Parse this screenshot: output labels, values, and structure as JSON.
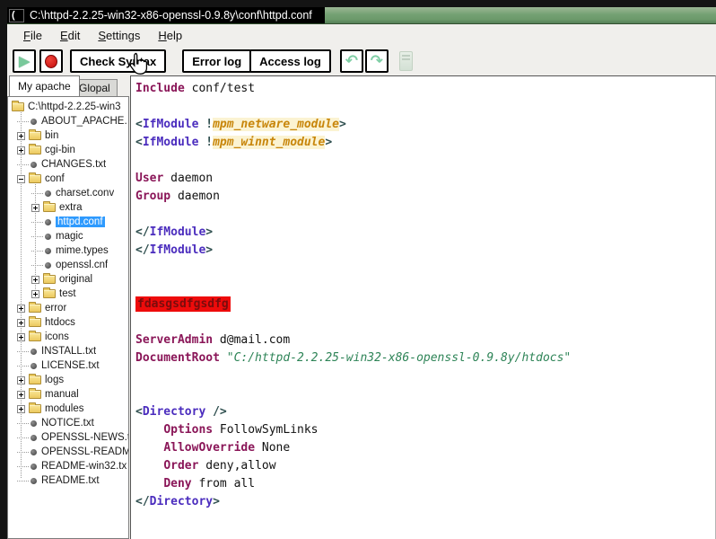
{
  "window": {
    "title": "C:\\httpd-2.2.25-win32-x86-openssl-0.9.8y\\conf\\httpd.conf",
    "app_icon_glyph": "("
  },
  "menu": {
    "items": [
      {
        "label": "File"
      },
      {
        "label": "Edit"
      },
      {
        "label": "Settings"
      },
      {
        "label": "Help"
      }
    ]
  },
  "toolbar": {
    "check_syntax_label": "Check Syntax",
    "error_log_label": "Error log",
    "access_log_label": "Access log",
    "play_glyph": "▶",
    "undo_glyph": "↶",
    "redo_glyph": "↷"
  },
  "sidebar": {
    "tabs": [
      {
        "label": "My apache",
        "active": true
      },
      {
        "label": "Glopal",
        "active": false
      }
    ],
    "tree": [
      {
        "label": "C:\\httpd-2.2.25-win3",
        "type": "folder",
        "depth": 0,
        "expand": "none",
        "selected": false
      },
      {
        "label": "ABOUT_APACHE.",
        "type": "file",
        "depth": 1,
        "expand": "none",
        "selected": false
      },
      {
        "label": "bin",
        "type": "folder",
        "depth": 1,
        "expand": "plus",
        "selected": false
      },
      {
        "label": "cgi-bin",
        "type": "folder",
        "depth": 1,
        "expand": "plus",
        "selected": false
      },
      {
        "label": "CHANGES.txt",
        "type": "file",
        "depth": 1,
        "expand": "none",
        "selected": false
      },
      {
        "label": "conf",
        "type": "folder",
        "depth": 1,
        "expand": "minus",
        "selected": false
      },
      {
        "label": "charset.conv",
        "type": "file",
        "depth": 2,
        "expand": "none",
        "selected": false
      },
      {
        "label": "extra",
        "type": "folder",
        "depth": 2,
        "expand": "plus",
        "selected": false
      },
      {
        "label": "httpd.conf",
        "type": "file",
        "depth": 2,
        "expand": "none",
        "selected": true
      },
      {
        "label": "magic",
        "type": "file",
        "depth": 2,
        "expand": "none",
        "selected": false
      },
      {
        "label": "mime.types",
        "type": "file",
        "depth": 2,
        "expand": "none",
        "selected": false
      },
      {
        "label": "openssl.cnf",
        "type": "file",
        "depth": 2,
        "expand": "none",
        "selected": false
      },
      {
        "label": "original",
        "type": "folder",
        "depth": 2,
        "expand": "plus",
        "selected": false
      },
      {
        "label": "test",
        "type": "folder",
        "depth": 2,
        "expand": "plus",
        "selected": false
      },
      {
        "label": "error",
        "type": "folder",
        "depth": 1,
        "expand": "plus",
        "selected": false
      },
      {
        "label": "htdocs",
        "type": "folder",
        "depth": 1,
        "expand": "plus",
        "selected": false
      },
      {
        "label": "icons",
        "type": "folder",
        "depth": 1,
        "expand": "plus",
        "selected": false
      },
      {
        "label": "INSTALL.txt",
        "type": "file",
        "depth": 1,
        "expand": "none",
        "selected": false
      },
      {
        "label": "LICENSE.txt",
        "type": "file",
        "depth": 1,
        "expand": "none",
        "selected": false
      },
      {
        "label": "logs",
        "type": "folder",
        "depth": 1,
        "expand": "plus",
        "selected": false
      },
      {
        "label": "manual",
        "type": "folder",
        "depth": 1,
        "expand": "plus",
        "selected": false
      },
      {
        "label": "modules",
        "type": "folder",
        "depth": 1,
        "expand": "plus",
        "selected": false
      },
      {
        "label": "NOTICE.txt",
        "type": "file",
        "depth": 1,
        "expand": "none",
        "selected": false
      },
      {
        "label": "OPENSSL-NEWS.t",
        "type": "file",
        "depth": 1,
        "expand": "none",
        "selected": false
      },
      {
        "label": "OPENSSL-READM",
        "type": "file",
        "depth": 1,
        "expand": "none",
        "selected": false
      },
      {
        "label": "README-win32.tx",
        "type": "file",
        "depth": 1,
        "expand": "none",
        "selected": false
      },
      {
        "label": "README.txt",
        "type": "file",
        "depth": 1,
        "expand": "none",
        "selected": false
      }
    ]
  },
  "editor": {
    "lines": [
      [
        {
          "t": "Include",
          "c": "k"
        },
        {
          "t": " conf/test",
          "c": "n"
        }
      ],
      [],
      [
        {
          "t": "<",
          "c": "p"
        },
        {
          "t": "IfModule",
          "c": "t"
        },
        {
          "t": " ",
          "c": "n"
        },
        {
          "t": "!",
          "c": "p"
        },
        {
          "t": "mpm_netware_module",
          "c": "m"
        },
        {
          "t": ">",
          "c": "p"
        }
      ],
      [
        {
          "t": "<",
          "c": "p"
        },
        {
          "t": "IfModule",
          "c": "t"
        },
        {
          "t": " ",
          "c": "n"
        },
        {
          "t": "!",
          "c": "p"
        },
        {
          "t": "mpm_winnt_module",
          "c": "m"
        },
        {
          "t": ">",
          "c": "p"
        }
      ],
      [],
      [
        {
          "t": "User",
          "c": "k"
        },
        {
          "t": " daemon",
          "c": "n"
        }
      ],
      [
        {
          "t": "Group",
          "c": "k"
        },
        {
          "t": " daemon",
          "c": "n"
        }
      ],
      [],
      [
        {
          "t": "</",
          "c": "p"
        },
        {
          "t": "IfModule",
          "c": "t"
        },
        {
          "t": ">",
          "c": "p"
        }
      ],
      [
        {
          "t": "</",
          "c": "p"
        },
        {
          "t": "IfModule",
          "c": "t"
        },
        {
          "t": ">",
          "c": "p"
        }
      ],
      [],
      [],
      [
        {
          "t": "fdasgsdfgsdfg",
          "c": "e"
        }
      ],
      [],
      [
        {
          "t": "ServerAdmin",
          "c": "k"
        },
        {
          "t": " d@mail.com",
          "c": "n"
        }
      ],
      [
        {
          "t": "DocumentRoot",
          "c": "k"
        },
        {
          "t": " ",
          "c": "n"
        },
        {
          "t": "\"C:/httpd-2.2.25-win32-x86-openssl-0.9.8y/htdocs\"",
          "c": "s"
        }
      ],
      [],
      [],
      [
        {
          "t": "<",
          "c": "p"
        },
        {
          "t": "Directory",
          "c": "t"
        },
        {
          "t": " ",
          "c": "n"
        },
        {
          "t": "/>",
          "c": "p"
        }
      ],
      [
        {
          "t": "    ",
          "c": "n"
        },
        {
          "t": "Options",
          "c": "k"
        },
        {
          "t": " FollowSymLinks",
          "c": "n"
        }
      ],
      [
        {
          "t": "    ",
          "c": "n"
        },
        {
          "t": "AllowOverride",
          "c": "k"
        },
        {
          "t": " None",
          "c": "n"
        }
      ],
      [
        {
          "t": "    ",
          "c": "n"
        },
        {
          "t": "Order",
          "c": "k"
        },
        {
          "t": " deny,allow",
          "c": "n"
        }
      ],
      [
        {
          "t": "    ",
          "c": "n"
        },
        {
          "t": "Deny",
          "c": "k"
        },
        {
          "t": " from all",
          "c": "n"
        }
      ],
      [
        {
          "t": "</",
          "c": "p"
        },
        {
          "t": "Directory",
          "c": "t"
        },
        {
          "t": ">",
          "c": "p"
        }
      ]
    ]
  },
  "colors": {
    "title_green": "#74a173",
    "keyword": "#8a1658",
    "tag": "#4b2dbe",
    "module": "#c8860b",
    "string": "#2e8457",
    "error_bg": "#ee0b0b",
    "error_text": "#7a0c0c",
    "selection": "#2e9afe"
  }
}
